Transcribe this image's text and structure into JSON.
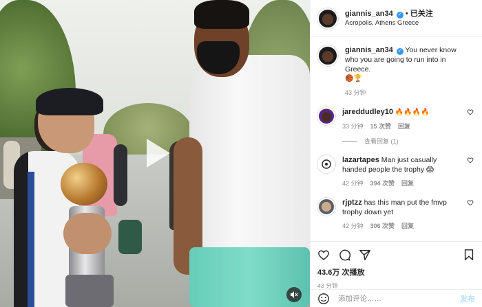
{
  "header": {
    "username": "giannis_an34",
    "separator": "•",
    "follow_label": "已关注",
    "location": "Acropolis, Athens Greece"
  },
  "caption": {
    "username": "giannis_an34",
    "text": "You never know who you are going to run into in Greece.",
    "emoji": "🏀🏆",
    "time": "43 分钟"
  },
  "comments": [
    {
      "username": "jareddudley10",
      "text": "🔥🔥🔥🔥",
      "time": "33 分钟",
      "likes": "15 次赞",
      "reply_label": "回复",
      "view_replies": "查看回复 (1)"
    },
    {
      "username": "lazartapes",
      "text": "Man just casually handed people the trophy 😱",
      "time": "42 分钟",
      "likes": "394 次赞",
      "reply_label": "回复"
    },
    {
      "username": "rjptzz",
      "text": "has this man put the fmvp trophy down yet",
      "time": "42 分钟",
      "likes": "306 次赞",
      "reply_label": "回复"
    }
  ],
  "stats": {
    "views": "43.6万 次播放",
    "ago": "43 分钟"
  },
  "comment_box": {
    "placeholder": "添加评论……",
    "post_label": "发布"
  },
  "colors": {
    "verified": "#3897f0",
    "post_disabled": "#b2dffc",
    "muted_text": "#8e8e8e"
  },
  "icons": [
    "play-icon",
    "audio-off-icon",
    "verified-icon",
    "heart-icon",
    "comment-icon",
    "share-icon",
    "bookmark-icon",
    "emoji-icon"
  ]
}
